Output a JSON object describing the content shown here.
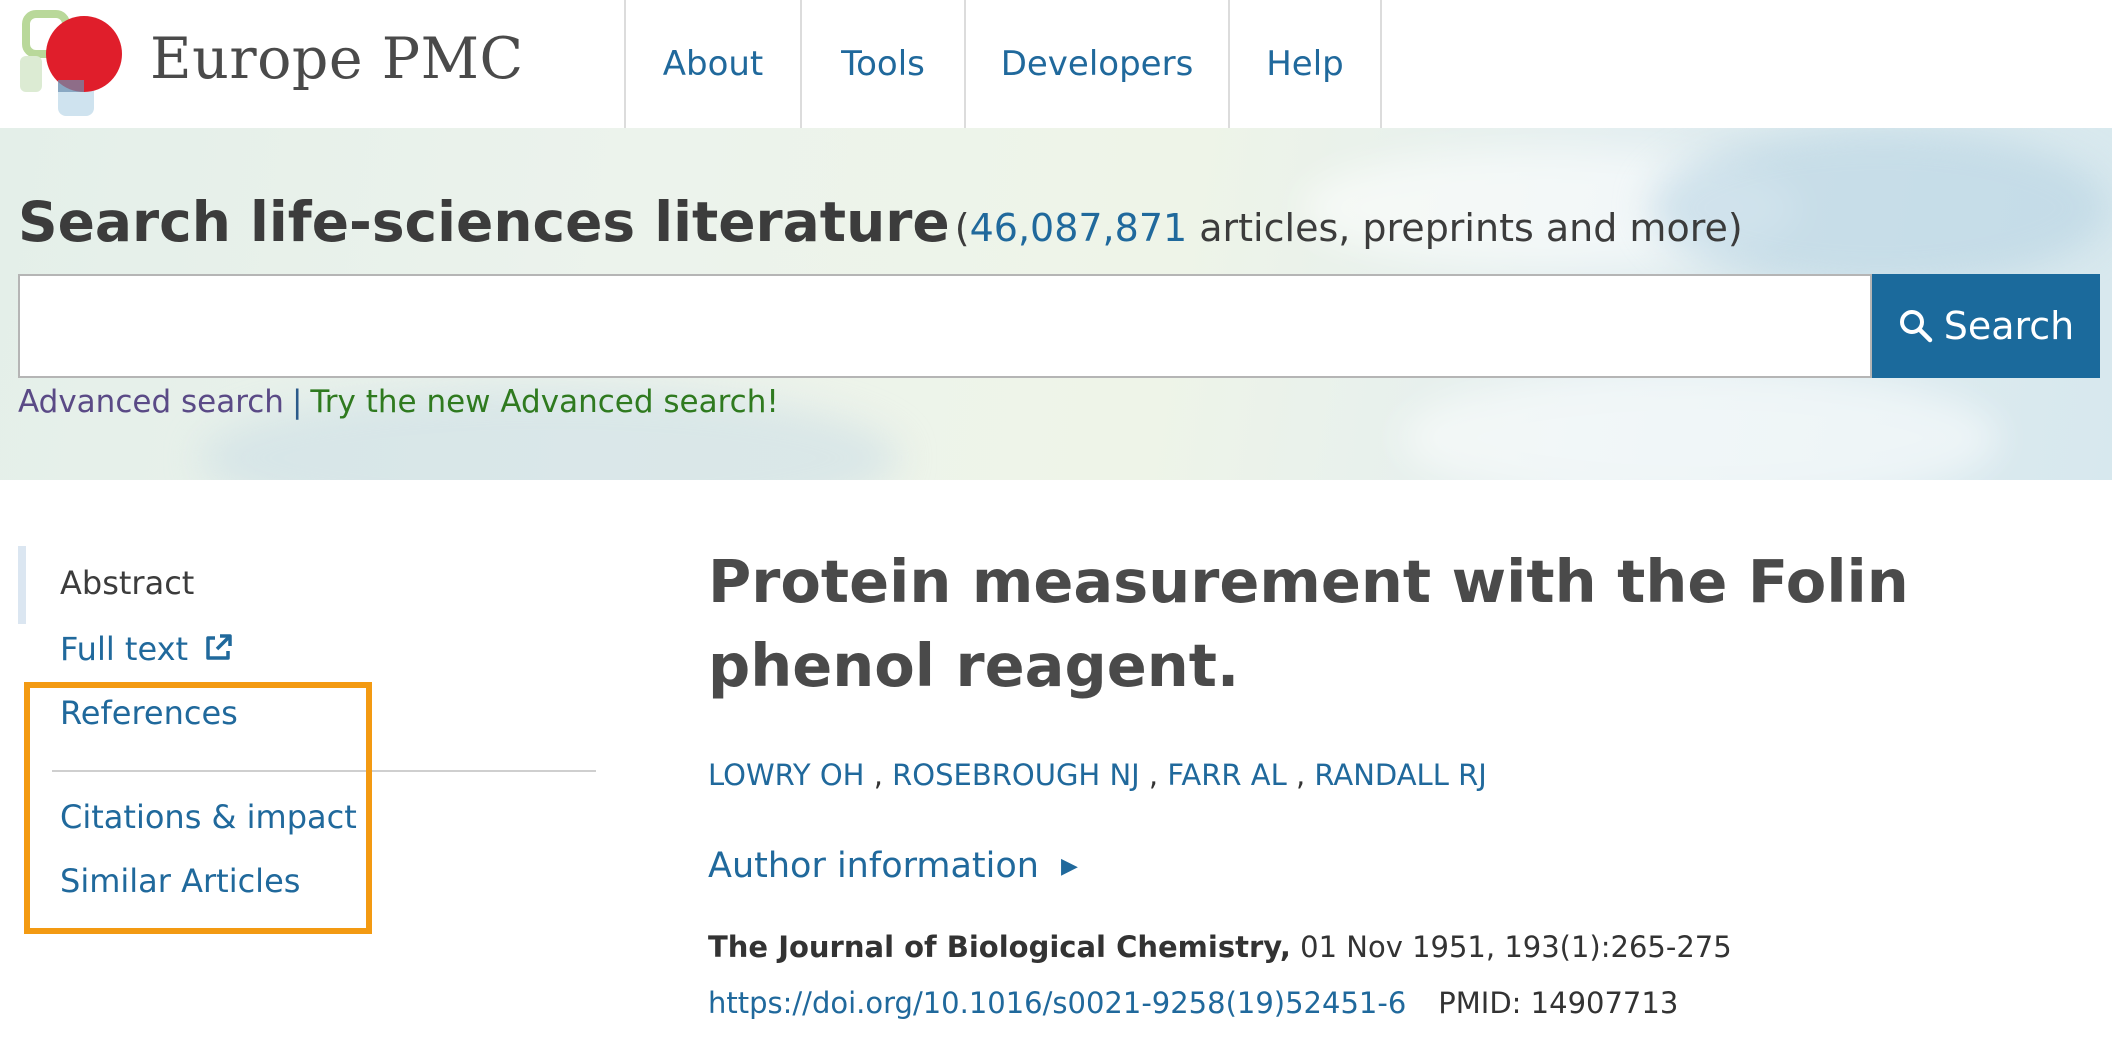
{
  "brand": {
    "logo_text": "Europe PMC",
    "accent_color": "#20699c",
    "logo_red": "#e01e2b"
  },
  "nav": {
    "items": [
      {
        "label": "About"
      },
      {
        "label": "Tools"
      },
      {
        "label": "Developers"
      },
      {
        "label": "Help"
      }
    ]
  },
  "search": {
    "title": "Search life-sciences literature",
    "count_open": "(",
    "count": "46,087,871",
    "count_suffix": " articles, preprints and more)",
    "input_value": "",
    "button_label": "Search",
    "button_icon": "search-icon",
    "advanced_link": "Advanced search",
    "separator": "|",
    "new_advanced_link": "Try the new Advanced search!"
  },
  "sidebar": {
    "items": [
      {
        "label": "Abstract",
        "active": true
      },
      {
        "label": "Full text",
        "icon": "external-link-icon"
      },
      {
        "label": "References"
      },
      {
        "label": "Citations & impact"
      },
      {
        "label": "Similar Articles"
      }
    ],
    "highlight_color": "#f39a12"
  },
  "article": {
    "title": "Protein measurement with the Folin phenol reagent.",
    "authors": [
      "LOWRY OH",
      "ROSEBROUGH NJ",
      "FARR AL",
      "RANDALL RJ"
    ],
    "author_separator": " , ",
    "author_info_label": "Author information",
    "journal": "The Journal of Biological Chemistry,",
    "journal_details": " 01 Nov 1951, 193(1):265-275",
    "doi": "https://doi.org/10.1016/s0021-9258(19)52451-6",
    "pmid": "PMID: 14907713"
  }
}
